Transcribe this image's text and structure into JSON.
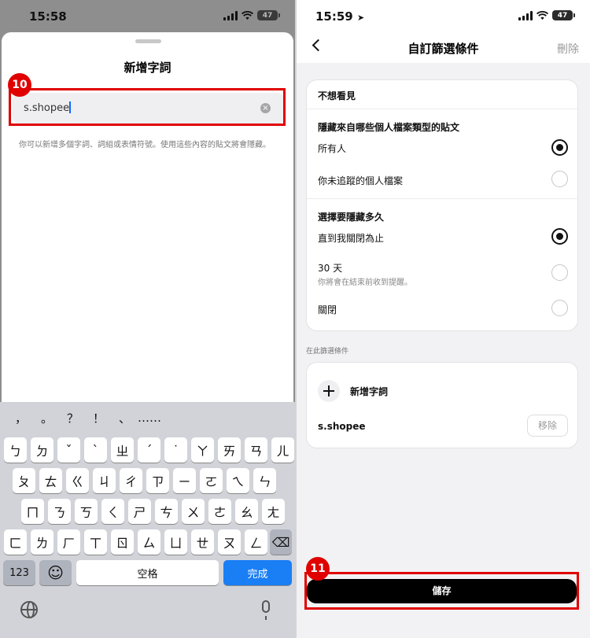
{
  "left": {
    "status": {
      "time": "15:58",
      "battery": "47"
    },
    "sheet": {
      "title": "新增字詞",
      "input_value": "s.shopee",
      "clear_icon": "×",
      "hint": "你可以新增多個字詞、詞組或表情符號。使用這些內容的貼文將會隱藏。"
    },
    "annotation_badge": "10",
    "keyboard": {
      "candidates": [
        "，",
        "。",
        "？",
        "！",
        "、",
        "……"
      ],
      "row1": [
        "ㄅ",
        "ㄉ",
        "ˇ",
        "ˋ",
        "ㄓ",
        "ˊ",
        "˙",
        "ㄚ",
        "ㄞ",
        "ㄢ",
        "ㄦ"
      ],
      "row2": [
        "ㄆ",
        "ㄊ",
        "ㄍ",
        "ㄐ",
        "ㄔ",
        "ㄗ",
        "ㄧ",
        "ㄛ",
        "ㄟ",
        "ㄣ"
      ],
      "row3": [
        "ㄇ",
        "ㄋ",
        "ㄎ",
        "ㄑ",
        "ㄕ",
        "ㄘ",
        "ㄨ",
        "ㄜ",
        "ㄠ",
        "ㄤ"
      ],
      "row4": [
        "ㄈ",
        "ㄌ",
        "ㄏ",
        "ㄒ",
        "ㄖ",
        "ㄙ",
        "ㄩ",
        "ㄝ",
        "ㄡ",
        "ㄥ"
      ],
      "delete_glyph": "⌫",
      "num_label": "123",
      "emoji_glyph": "☺",
      "space_label": "空格",
      "done_label": "完成"
    }
  },
  "right": {
    "status": {
      "time": "15:59",
      "battery": "47"
    },
    "nav": {
      "title": "自訂篩選條件",
      "delete_label": "刪除"
    },
    "card1": {
      "header": "不想看見",
      "section1_title": "隱藏來自哪些個人檔案類型的貼文",
      "opt_everyone": "所有人",
      "opt_not_following": "你未追蹤的個人檔案",
      "section2_title": "選擇要隱藏多久",
      "opt_until_off": "直到我關閉為止",
      "opt_30_days": "30 天",
      "opt_30_days_sub": "你將會在結束前收到提醒。",
      "opt_off": "關閉"
    },
    "caption": "在此篩選條件",
    "card2": {
      "add_word_label": "新增字詞",
      "word": "s.shopee",
      "remove_label": "移除"
    },
    "annotation_badge": "11",
    "save_label": "儲存"
  },
  "colors": {
    "annotation_red": "#e00000",
    "done_blue": "#1a7ef5"
  }
}
